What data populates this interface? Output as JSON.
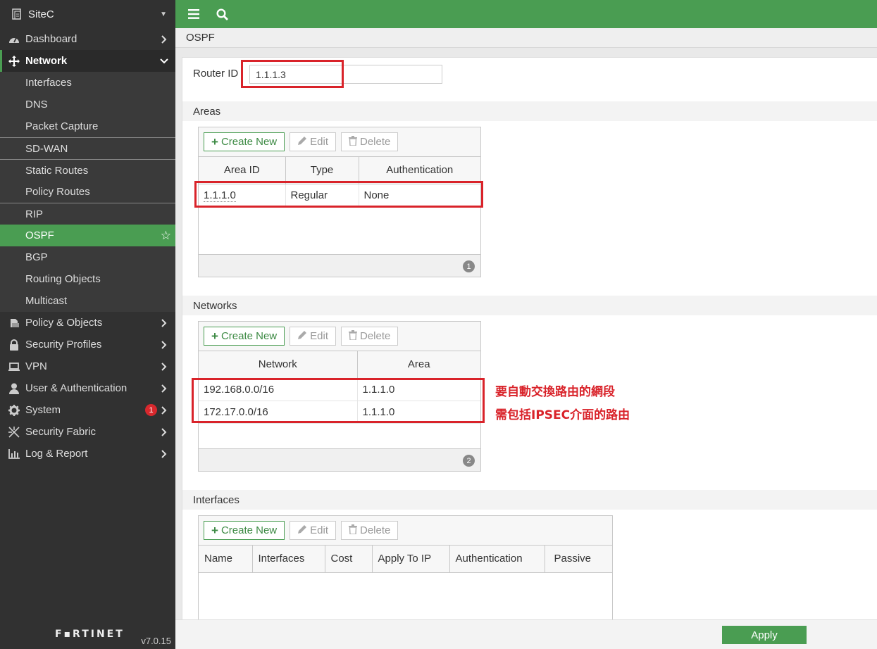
{
  "sidebar": {
    "site_name": "SiteC",
    "items": [
      {
        "label": "Dashboard",
        "icon": "dashboard-icon"
      },
      {
        "label": "Network",
        "icon": "network-icon"
      },
      {
        "label": "Interfaces"
      },
      {
        "label": "DNS"
      },
      {
        "label": "Packet Capture"
      },
      {
        "label": "SD-WAN"
      },
      {
        "label": "Static Routes"
      },
      {
        "label": "Policy Routes"
      },
      {
        "label": "RIP"
      },
      {
        "label": "OSPF"
      },
      {
        "label": "BGP"
      },
      {
        "label": "Routing Objects"
      },
      {
        "label": "Multicast"
      },
      {
        "label": "Policy & Objects",
        "icon": "policy-icon"
      },
      {
        "label": "Security Profiles",
        "icon": "lock-icon"
      },
      {
        "label": "VPN",
        "icon": "laptop-icon"
      },
      {
        "label": "User & Authentication",
        "icon": "user-icon"
      },
      {
        "label": "System",
        "icon": "gear-icon",
        "badge": "1"
      },
      {
        "label": "Security Fabric",
        "icon": "fabric-icon"
      },
      {
        "label": "Log & Report",
        "icon": "chart-icon"
      }
    ],
    "logo": "F▪RTINET",
    "version": "v7.0.15"
  },
  "page": {
    "title": "OSPF",
    "router_id_label": "Router ID",
    "router_id_value": "1.1.1.3"
  },
  "toolbar": {
    "create_new": "Create New",
    "edit": "Edit",
    "delete": "Delete"
  },
  "areas": {
    "title": "Areas",
    "columns": [
      "Area ID",
      "Type",
      "Authentication"
    ],
    "rows": [
      {
        "area_id": "1.1.1.0",
        "type": "Regular",
        "auth": "None"
      }
    ],
    "count": "1"
  },
  "networks": {
    "title": "Networks",
    "columns": [
      "Network",
      "Area"
    ],
    "rows": [
      {
        "network": "192.168.0.0/16",
        "area": "1.1.1.0"
      },
      {
        "network": "172.17.0.0/16",
        "area": "1.1.1.0"
      }
    ],
    "count": "2"
  },
  "interfaces": {
    "title": "Interfaces",
    "columns": [
      "Name",
      "Interfaces",
      "Cost",
      "Apply To IP",
      "Authentication",
      "Passive"
    ]
  },
  "annotations": {
    "line1": "要自動交換路由的網段",
    "line2": "需包括IPSEC介面的路由"
  },
  "footer": {
    "apply": "Apply"
  },
  "colors": {
    "accent_green": "#4a9d52",
    "highlight_red": "#d9232a",
    "sidebar_bg": "#313131"
  }
}
